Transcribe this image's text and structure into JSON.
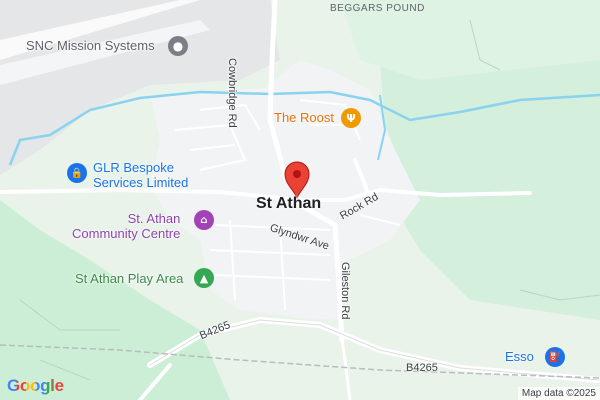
{
  "map": {
    "place_name": "St Athan",
    "area_label": "BEGGARS POUND",
    "pois": {
      "snc": "SNC Mission Systems",
      "glr": "GLR Bespoke\nServices Limited",
      "community": "St. Athan\nCommunity Centre",
      "play_area": "St Athan Play Area",
      "roost": "The Roost",
      "esso": "Esso"
    },
    "roads": {
      "cowbridge": "Cowbridge Rd",
      "glyndwr": "Glyndwr Ave",
      "rock": "Rock Rd",
      "gileston": "Gileston Rd",
      "b4265_left": "B4265",
      "b4265_right": "B4265"
    },
    "icons": {
      "snc": "place-pin-icon",
      "glr": "lock-icon",
      "community": "community-building-icon",
      "play_area": "tree-icon",
      "roost": "restaurant-icon",
      "esso": "fuel-pump-icon",
      "marker": "red-location-marker-icon"
    },
    "colors": {
      "land": "#e9f3ea",
      "park": "#c8ebd1",
      "urban": "#f1f3f4",
      "road": "#ffffff",
      "water": "#8ad3f0",
      "marker": "#ea4335",
      "poi_blue": "#1a73e8",
      "poi_purple": "#8e44ad",
      "poi_green": "#3c8a4a",
      "poi_orange": "#e8710a"
    }
  },
  "footer": {
    "logo": "Google",
    "attribution": "Map data ©2025"
  }
}
